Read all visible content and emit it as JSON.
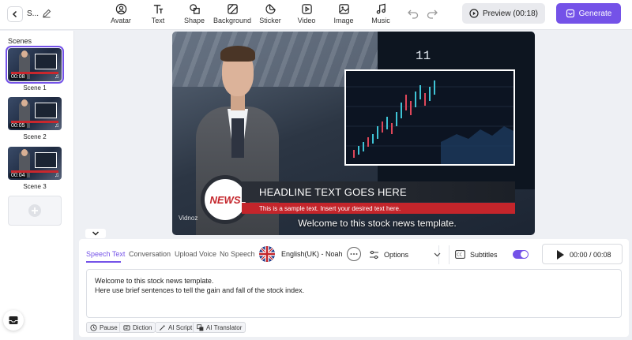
{
  "header": {
    "project_name": "S...",
    "tools": [
      {
        "label": "Avatar",
        "icon": "avatar-icon"
      },
      {
        "label": "Text",
        "icon": "text-icon"
      },
      {
        "label": "Shape",
        "icon": "shape-icon"
      },
      {
        "label": "Background",
        "icon": "background-icon"
      },
      {
        "label": "Sticker",
        "icon": "sticker-icon"
      },
      {
        "label": "Video",
        "icon": "video-icon"
      },
      {
        "label": "Image",
        "icon": "image-icon"
      },
      {
        "label": "Music",
        "icon": "music-icon"
      }
    ],
    "preview_label": "Preview (00:18)",
    "generate_label": "Generate"
  },
  "sidebar": {
    "title": "Scenes",
    "scenes": [
      {
        "label": "Scene 1",
        "duration": "00:08",
        "active": true
      },
      {
        "label": "Scene 2",
        "duration": "00:05",
        "active": false
      },
      {
        "label": "Scene 3",
        "duration": "00:04",
        "active": false
      }
    ]
  },
  "canvas": {
    "news_badge": "NEWS",
    "headline": "HEADLINE TEXT GOES HERE",
    "subline": "This is a sample text. Insert your desired text here.",
    "caption": "Welcome to this stock news template.",
    "watermark": "Vidnoz",
    "board_number": "11"
  },
  "editor": {
    "tabs": [
      "Speech Text",
      "Conversation",
      "Upload Voice",
      "No Speech"
    ],
    "active_tab": "Speech Text",
    "voice": "English(UK) - Noah",
    "options_label": "Options",
    "subtitles_label": "Subtitles",
    "subtitles_on": true,
    "time": "00:00 / 00:08",
    "script_lines": [
      "Welcome to this stock news template.",
      "Here use brief sentences to tell the gain and fall of the stock index."
    ],
    "chips": [
      "Pause",
      "Diction",
      "AI Script",
      "AI Translator"
    ]
  },
  "colors": {
    "accent": "#7452e8",
    "news_red": "#c4252b"
  }
}
